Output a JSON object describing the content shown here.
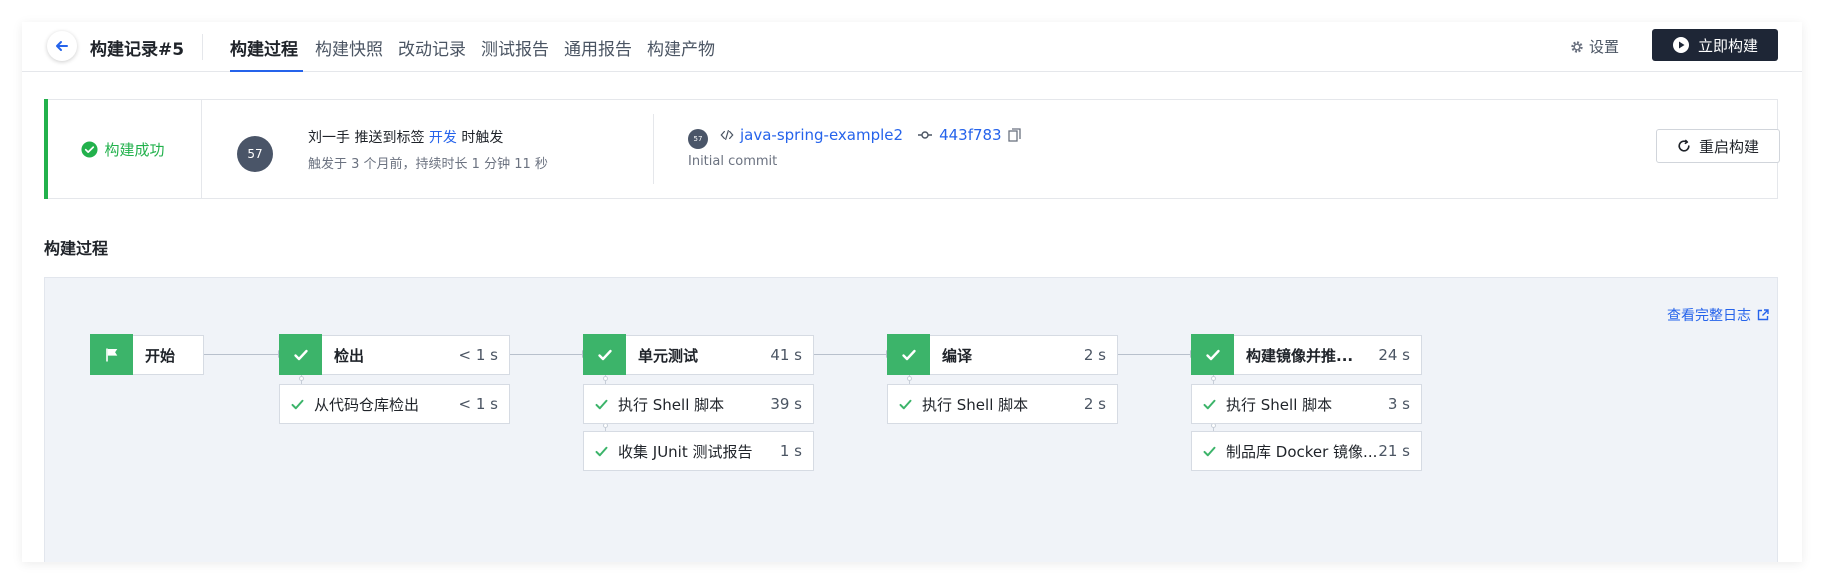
{
  "header": {
    "record_title": "构建记录#5",
    "tabs": [
      {
        "label": "构建过程",
        "active": true
      },
      {
        "label": "构建快照"
      },
      {
        "label": "改动记录"
      },
      {
        "label": "测试报告"
      },
      {
        "label": "通用报告"
      },
      {
        "label": "构建产物"
      }
    ],
    "settings_label": "设置",
    "build_now_label": "立即构建"
  },
  "status": {
    "label": "构建成功",
    "color": "#22b14c",
    "avatar_text": "57",
    "trigger_user": "刘一手",
    "trigger_action": "推送到标签",
    "trigger_tag": "开发",
    "trigger_suffix": "时触发",
    "trigger_detail": "触发于 3 个月前，持续时长 1 分钟 11 秒",
    "repo_avatar_text": "57",
    "repo_name": "java-spring-example2",
    "commit_hash": "443f783",
    "commit_message": "Initial commit",
    "restart_label": "重启构建"
  },
  "section_title": "构建过程",
  "pipeline": {
    "full_log_label": "查看完整日志",
    "start_label": "开始",
    "stages": [
      {
        "name": "检出",
        "duration": "< 1 s",
        "steps": [
          {
            "name": "从代码仓库检出",
            "duration": "< 1 s"
          }
        ]
      },
      {
        "name": "单元测试",
        "duration": "41 s",
        "steps": [
          {
            "name": "执行 Shell 脚本",
            "duration": "39 s"
          },
          {
            "name": "收集 JUnit 测试报告",
            "duration": "1 s"
          }
        ]
      },
      {
        "name": "编译",
        "duration": "2 s",
        "steps": [
          {
            "name": "执行 Shell 脚本",
            "duration": "2 s"
          }
        ]
      },
      {
        "name": "构建镜像并推...",
        "duration": "24 s",
        "steps": [
          {
            "name": "执行 Shell 脚本",
            "duration": "3 s"
          },
          {
            "name": "制品库 Docker 镜像...",
            "duration": "21 s"
          }
        ]
      }
    ],
    "colors": {
      "success": "#3cb46a",
      "link": "#2563eb"
    }
  }
}
